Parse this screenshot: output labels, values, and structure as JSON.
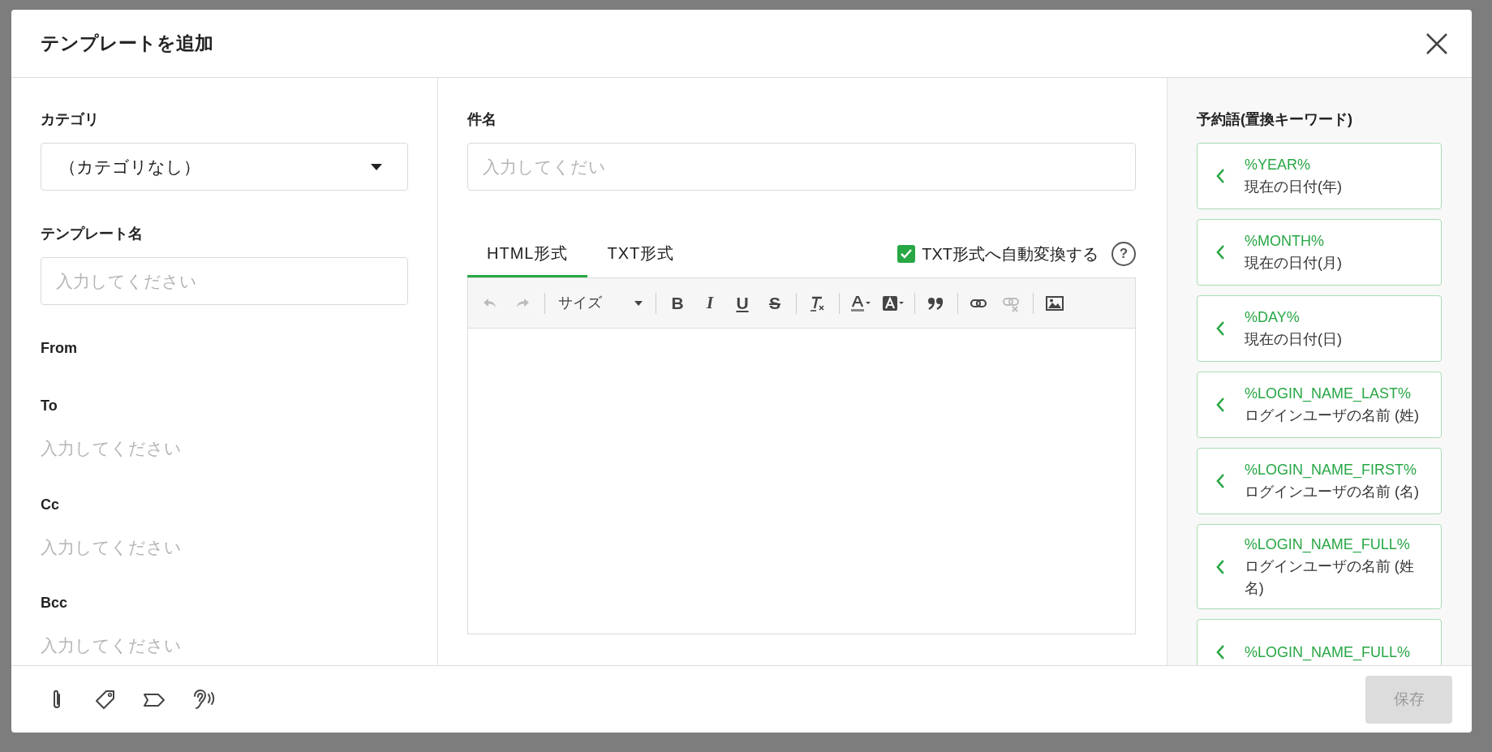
{
  "dialog": {
    "title": "テンプレートを追加"
  },
  "fields": [
    {
      "kind": "select",
      "label": "カテゴリ",
      "value": "（カテゴリなし）"
    },
    {
      "kind": "input",
      "label": "テンプレート名",
      "placeholder": "入力してください"
    },
    {
      "kind": "static",
      "label": "From"
    },
    {
      "kind": "bare",
      "label": "To",
      "placeholder": "入力してください"
    },
    {
      "kind": "bare",
      "label": "Cc",
      "placeholder": "入力してください"
    },
    {
      "kind": "bare",
      "label": "Bcc",
      "placeholder": "入力してください"
    }
  ],
  "subject": {
    "label": "件名",
    "placeholder": "入力してくだい"
  },
  "editor_tabs": [
    {
      "label": "HTML形式",
      "selected": true
    },
    {
      "label": "TXT形式",
      "selected": false
    }
  ],
  "auto_convert": {
    "label": "TXT形式へ自動変換する",
    "checked": true,
    "help": "?"
  },
  "toolbar": [
    {
      "kind": "undo",
      "disabled": true
    },
    {
      "kind": "redo",
      "disabled": true
    },
    {
      "kind": "separator"
    },
    {
      "kind": "size",
      "label": "サイズ"
    },
    {
      "kind": "separator"
    },
    {
      "kind": "bold",
      "glyph": "B",
      "disabled": false
    },
    {
      "kind": "italic",
      "glyph": "I",
      "disabled": false
    },
    {
      "kind": "underline",
      "glyph": "U",
      "disabled": false
    },
    {
      "kind": "strike",
      "glyph": "S",
      "disabled": false
    },
    {
      "kind": "separator"
    },
    {
      "kind": "clear",
      "disabled": false
    },
    {
      "kind": "separator"
    },
    {
      "kind": "textcolor",
      "disabled": false
    },
    {
      "kind": "bgcolor",
      "disabled": false
    },
    {
      "kind": "separator"
    },
    {
      "kind": "quote",
      "disabled": false
    },
    {
      "kind": "separator"
    },
    {
      "kind": "link",
      "disabled": false
    },
    {
      "kind": "unlink",
      "disabled": true
    },
    {
      "kind": "separator"
    },
    {
      "kind": "image",
      "disabled": false
    }
  ],
  "keywords_panel": {
    "title": "予約語(置換キーワード)",
    "items": [
      {
        "key": "%YEAR%",
        "description": "現在の日付(年)"
      },
      {
        "key": "%MONTH%",
        "description": "現在の日付(月)"
      },
      {
        "key": "%DAY%",
        "description": "現在の日付(日)"
      },
      {
        "key": "%LOGIN_NAME_LAST%",
        "description": "ログインユーザの名前 (姓)"
      },
      {
        "key": "%LOGIN_NAME_FIRST%",
        "description": "ログインユーザの名前 (名)"
      },
      {
        "key": "%LOGIN_NAME_FULL%",
        "description": "ログインユーザの名前 (姓名)"
      },
      {
        "key": "%LOGIN_NAME_FULL%"
      }
    ]
  },
  "footer": {
    "tools": [
      {
        "kind": "paperclip"
      },
      {
        "kind": "tag"
      },
      {
        "kind": "label"
      },
      {
        "kind": "ear"
      }
    ],
    "save": {
      "label": "保存",
      "disabled": true
    }
  }
}
